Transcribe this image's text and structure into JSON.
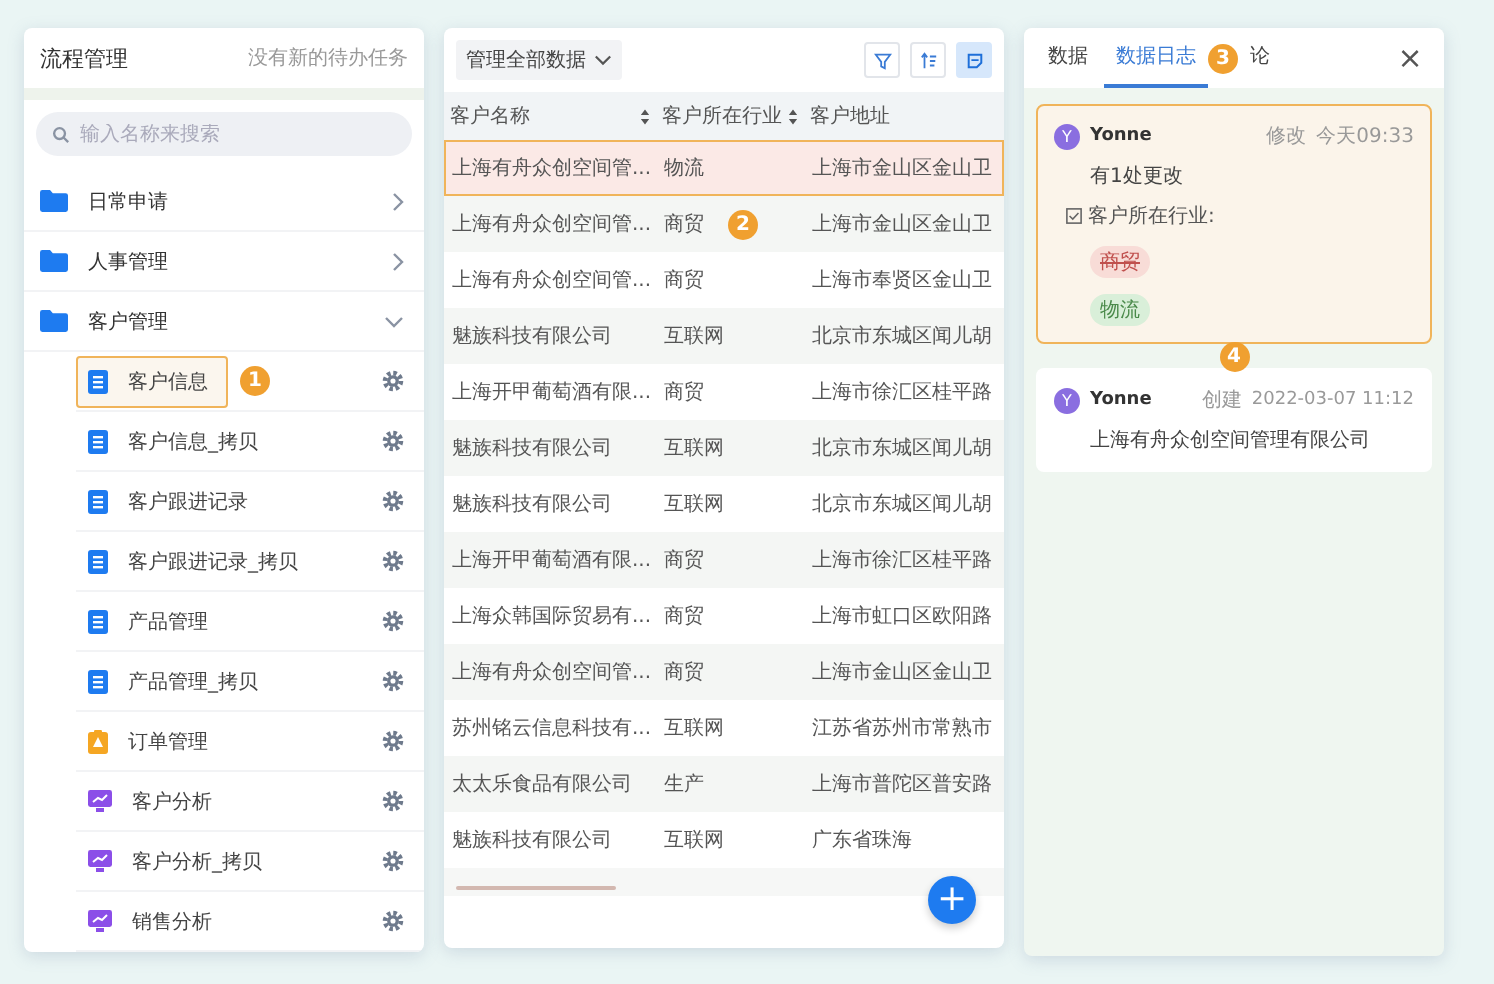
{
  "flow_panel": {
    "title": "流程管理",
    "notice": "没有新的待办任务",
    "search": {
      "placeholder": "输入名称来搜索"
    },
    "tree": [
      {
        "label": "日常申请",
        "expanded": false
      },
      {
        "label": "人事管理",
        "expanded": false
      },
      {
        "label": "客户管理",
        "expanded": true,
        "children": [
          {
            "label": "客户信息",
            "kind": "form",
            "selected": true,
            "callout": "1"
          },
          {
            "label": "客户信息_拷贝",
            "kind": "form",
            "selected": false
          },
          {
            "label": "客户跟进记录",
            "kind": "form",
            "selected": false
          },
          {
            "label": "客户跟进记录_拷贝",
            "kind": "form",
            "selected": false
          },
          {
            "label": "产品管理",
            "kind": "form",
            "selected": false
          },
          {
            "label": "产品管理_拷贝",
            "kind": "form",
            "selected": false
          },
          {
            "label": "订单管理",
            "kind": "order",
            "selected": false
          },
          {
            "label": "客户分析",
            "kind": "report",
            "selected": false
          },
          {
            "label": "客户分析_拷贝",
            "kind": "report",
            "selected": false
          },
          {
            "label": "销售分析",
            "kind": "report",
            "selected": false
          }
        ]
      }
    ]
  },
  "data_panel": {
    "scope": "管理全部数据",
    "tools": [
      {
        "kind": "filter",
        "selected": false
      },
      {
        "kind": "sort",
        "selected": false
      },
      {
        "kind": "note",
        "selected": true
      }
    ],
    "columns": [
      {
        "label": "客户名称",
        "sortable": true
      },
      {
        "label": "客户所在行业",
        "sortable": true
      },
      {
        "label": "客户地址",
        "sortable": false
      }
    ],
    "rows": [
      {
        "cells": [
          "上海有舟众创空间管...",
          "物流",
          "上海市金山区金山卫"
        ],
        "selected": true
      },
      {
        "cells": [
          "上海有舟众创空间管...",
          "商贸",
          "上海市金山区金山卫"
        ],
        "selected": false,
        "callout": "2"
      },
      {
        "cells": [
          "上海有舟众创空间管...",
          "商贸",
          "上海市奉贤区金山卫"
        ],
        "selected": false
      },
      {
        "cells": [
          "魅族科技有限公司",
          "互联网",
          "北京市东城区闻儿胡"
        ],
        "selected": false
      },
      {
        "cells": [
          "上海开甲葡萄酒有限...",
          "商贸",
          "上海市徐汇区桂平路"
        ],
        "selected": false
      },
      {
        "cells": [
          "魅族科技有限公司",
          "互联网",
          "北京市东城区闻儿胡"
        ],
        "selected": false
      },
      {
        "cells": [
          "魅族科技有限公司",
          "互联网",
          "北京市东城区闻儿胡"
        ],
        "selected": false
      },
      {
        "cells": [
          "上海开甲葡萄酒有限...",
          "商贸",
          "上海市徐汇区桂平路"
        ],
        "selected": false
      },
      {
        "cells": [
          "上海众韩国际贸易有...",
          "商贸",
          "上海市虹口区欧阳路"
        ],
        "selected": false
      },
      {
        "cells": [
          "上海有舟众创空间管...",
          "商贸",
          "上海市金山区金山卫"
        ],
        "selected": false
      },
      {
        "cells": [
          "苏州铭云信息科技有...",
          "互联网",
          "江苏省苏州市常熟市"
        ],
        "selected": false
      },
      {
        "cells": [
          "太太乐食品有限公司",
          "生产",
          "上海市普陀区普安路"
        ],
        "selected": false
      },
      {
        "cells": [
          "魅族科技有限公司",
          "互联网",
          "广东省珠海"
        ],
        "selected": false
      }
    ],
    "add_button": "+"
  },
  "log_panel": {
    "tabs": [
      {
        "label": "数据",
        "selected": false
      },
      {
        "label": "数据日志",
        "selected": true,
        "callout": "3"
      },
      {
        "label": "论",
        "selected": false
      }
    ],
    "close": "×",
    "entries": [
      {
        "avatar": "Y",
        "user": "Yonne",
        "action": "修改",
        "time": "今天09:33",
        "selected": true,
        "summary": "有1处更改",
        "field": "客户所在行业:",
        "tags": [
          {
            "label": "商贸",
            "kind": "old"
          },
          {
            "label": "物流",
            "kind": "new"
          }
        ],
        "callout": "4"
      },
      {
        "avatar": "Y",
        "user": "Yonne",
        "action": "创建",
        "time": "2022-03-07 11:12",
        "selected": false,
        "content": "上海有舟众创空间管理有限公司"
      }
    ]
  }
}
